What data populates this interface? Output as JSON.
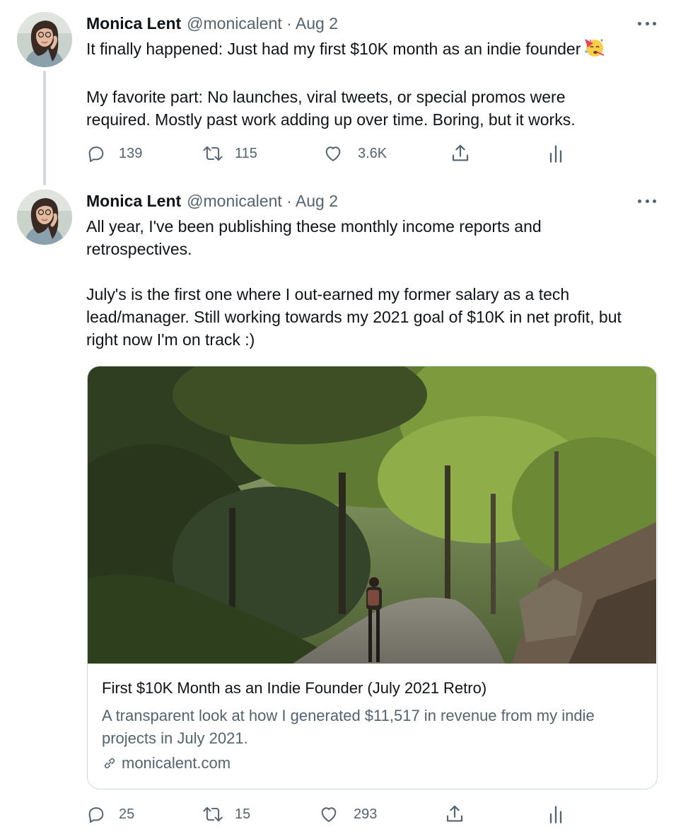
{
  "tweets": [
    {
      "author_name": "Monica Lent",
      "handle": "@monicalent",
      "date": "Aug 2",
      "meta": "@monicalent · Aug 2",
      "text_lines": [
        "It finally happened: Just had my first $10K month as an indie founder",
        "",
        "My favorite part: No launches, viral tweets, or special promos were",
        "required. Mostly past work adding up over time. Boring, but it works."
      ],
      "emoji": "partying-face-emoji",
      "replies": "139",
      "retweets": "115",
      "likes": "3.6K"
    },
    {
      "author_name": "Monica Lent",
      "handle": "@monicalent",
      "date": "Aug 2",
      "meta": "@monicalent · Aug 2",
      "text_lines": [
        "All year, I've been publishing these monthly income reports and",
        "retrospectives.",
        "",
        "July's is the first one where I out-earned my former salary as a tech",
        "lead/manager. Still working towards my 2021 goal of $10K in net profit, but",
        "right now I'm on track :)"
      ],
      "card": {
        "title": "First $10K Month as an Indie Founder (July 2021 Retro)",
        "description_lines": [
          "A transparent look at how I generated $11,517 in revenue from my indie",
          "projects in July 2021."
        ],
        "domain": "monicalent.com",
        "image": "forest-path-photo"
      },
      "replies": "25",
      "retweets": "15",
      "likes": "293"
    }
  ],
  "icons": {
    "reply": "reply-icon",
    "retweet": "retweet-icon",
    "like": "heart-icon",
    "share": "share-icon",
    "analytics": "analytics-icon",
    "more": "more-icon",
    "link": "link-icon"
  },
  "colors": {
    "text": "#0f1419",
    "secondary": "#536471",
    "border": "#cfd9de"
  }
}
